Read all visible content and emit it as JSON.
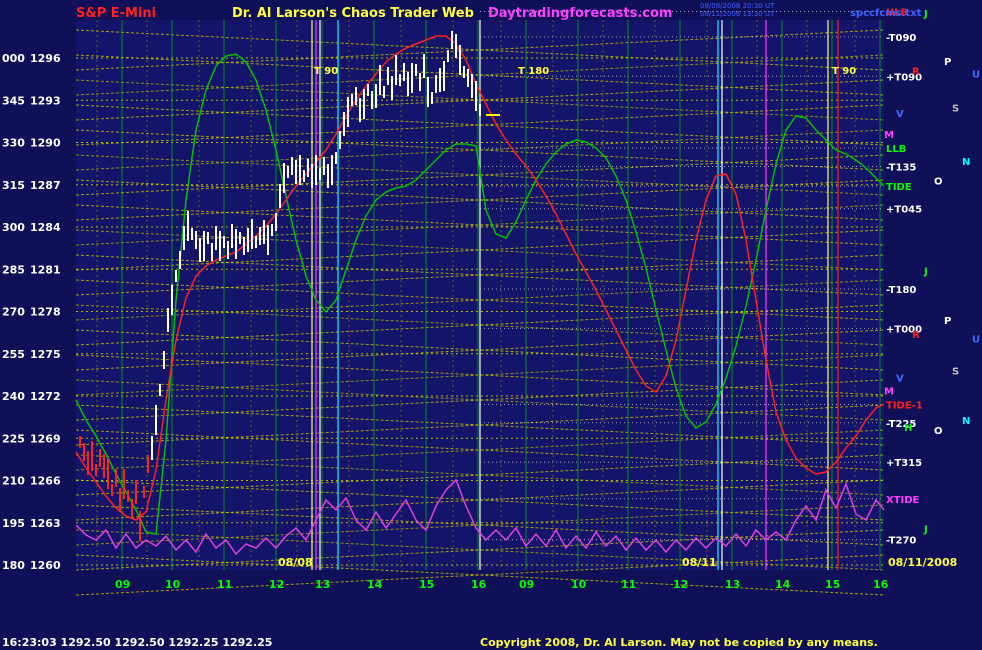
{
  "header": {
    "instrument": "S&P E-Mini",
    "site": "Dr. Al Larson's Chaos Trader Web",
    "url": "Daytradingforecasts.com",
    "stamp_line1": "08/08/2008 20:30 UT",
    "stamp_line2": "08/11/2008 13:30 UT",
    "file_label": "spccfcms.txt"
  },
  "footer": {
    "quote": "16:23:03  1292.50  1292.50  1292.25  1292.25",
    "copyright": "Copyright 2008, Dr. Al Larson. May not be copied by any means."
  },
  "colors": {
    "background": "#101058",
    "plot_background": "#14146a",
    "price_bar": "#ffffff",
    "grid": "#c8c800",
    "time_line": "#00ff00",
    "red_wave": "#ff2020",
    "green_wave": "#00c000",
    "magenta_wave": "#e040e0"
  },
  "chart_data": {
    "type": "line",
    "title": "S&P E-Mini",
    "y_left_labels": [
      "000",
      "345",
      "330",
      "315",
      "300",
      "285",
      "270",
      "255",
      "240",
      "225",
      "210",
      "195",
      "180"
    ],
    "y_prices": [
      1296,
      1293,
      1290,
      1287,
      1284,
      1281,
      1278,
      1275,
      1272,
      1269,
      1266,
      1263,
      1260
    ],
    "ylim": [
      1260,
      1298.7
    ],
    "x_hour_labels": [
      "09",
      "10",
      "11",
      "12",
      "13",
      "14",
      "15",
      "16",
      "09",
      "10",
      "11",
      "12",
      "13",
      "14",
      "15",
      "16"
    ],
    "date_labels": [
      "08/08",
      "08/11",
      "08/11/2008"
    ],
    "right_labels": [
      {
        "text": "-T090",
        "price": 1297.5,
        "color": "#ffffff"
      },
      {
        "text": "+T090",
        "price": 1294.7,
        "color": "#ffffff"
      },
      {
        "text": "-T135",
        "price": 1288.3,
        "color": "#ffffff"
      },
      {
        "text": "+T045",
        "price": 1285.3,
        "color": "#ffffff"
      },
      {
        "text": "-T180",
        "price": 1279.6,
        "color": "#ffffff"
      },
      {
        "text": "+T000",
        "price": 1276.8,
        "color": "#ffffff"
      },
      {
        "text": "-T225",
        "price": 1270.1,
        "color": "#ffffff"
      },
      {
        "text": "+T315",
        "price": 1267.3,
        "color": "#ffffff"
      },
      {
        "text": "-T270",
        "price": 1261.8,
        "color": "#ffffff"
      },
      {
        "text": "ULB",
        "price": 1299.3,
        "color": "#ff2020"
      },
      {
        "text": "LLB",
        "price": 1289.6,
        "color": "#00ff00"
      },
      {
        "text": "TIDE",
        "price": 1286.9,
        "color": "#00ff00"
      },
      {
        "text": "TIDE-1",
        "price": 1271.4,
        "color": "#ff2020"
      },
      {
        "text": "XTIDE",
        "price": 1264.7,
        "color": "#ff40ff"
      }
    ],
    "planet_glyphs": [
      {
        "text": "J",
        "price": 1299.2,
        "color": "#00ff00"
      },
      {
        "text": "P",
        "price": 1295.8,
        "color": "#ffffff"
      },
      {
        "text": "U",
        "price": 1294.9,
        "color": "#3f6bff"
      },
      {
        "text": "R",
        "price": 1295.1,
        "color": "#ff2020"
      },
      {
        "text": "V",
        "price": 1292.1,
        "color": "#3f6bff"
      },
      {
        "text": "S",
        "price": 1292.5,
        "color": "#c0c0c0"
      },
      {
        "text": "M",
        "price": 1290.6,
        "color": "#ff40ff"
      },
      {
        "text": "N",
        "price": 1288.7,
        "color": "#00ffff"
      },
      {
        "text": "O",
        "price": 1287.3,
        "color": "#ffffff"
      },
      {
        "text": "J",
        "price": 1280.9,
        "color": "#00ff00"
      },
      {
        "text": "P",
        "price": 1277.4,
        "color": "#ffffff"
      },
      {
        "text": "R",
        "price": 1276.4,
        "color": "#ff2020"
      },
      {
        "text": "U",
        "price": 1276.1,
        "color": "#3f6bff"
      },
      {
        "text": "S",
        "price": 1273.8,
        "color": "#c0c0c0"
      },
      {
        "text": "V",
        "price": 1273.3,
        "color": "#3f6bff"
      },
      {
        "text": "M",
        "price": 1272.4,
        "color": "#ff40ff"
      },
      {
        "text": "N",
        "price": 1270.3,
        "color": "#00ffff"
      },
      {
        "text": "H",
        "price": 1269.8,
        "color": "#00ff00"
      },
      {
        "text": "O",
        "price": 1269.6,
        "color": "#ffffff"
      },
      {
        "text": "J",
        "price": 1262.6,
        "color": "#00ff00"
      }
    ],
    "time_line_labels": [
      "T 90",
      "T 180",
      "T 90"
    ],
    "price_series": [
      [
        80,
        442
      ],
      [
        84,
        452
      ],
      [
        88,
        463
      ],
      [
        92,
        456
      ],
      [
        96,
        470
      ],
      [
        100,
        458
      ],
      [
        104,
        466
      ],
      [
        108,
        474
      ],
      [
        112,
        490
      ],
      [
        116,
        478
      ],
      [
        120,
        500
      ],
      [
        124,
        484
      ],
      [
        128,
        496
      ],
      [
        132,
        508
      ],
      [
        136,
        492
      ],
      [
        140,
        526
      ],
      [
        144,
        492
      ],
      [
        148,
        464
      ],
      [
        152,
        448
      ],
      [
        156,
        420
      ],
      [
        160,
        390
      ],
      [
        164,
        360
      ],
      [
        168,
        320
      ],
      [
        172,
        300
      ],
      [
        176,
        276
      ],
      [
        180,
        260
      ],
      [
        184,
        238
      ],
      [
        188,
        226
      ],
      [
        192,
        234
      ],
      [
        196,
        240
      ],
      [
        200,
        250
      ],
      [
        204,
        246
      ],
      [
        208,
        238
      ],
      [
        212,
        252
      ],
      [
        216,
        238
      ],
      [
        220,
        246
      ],
      [
        224,
        242
      ],
      [
        228,
        250
      ],
      [
        232,
        236
      ],
      [
        236,
        244
      ],
      [
        240,
        238
      ],
      [
        244,
        246
      ],
      [
        248,
        240
      ],
      [
        252,
        234
      ],
      [
        256,
        242
      ],
      [
        260,
        236
      ],
      [
        264,
        232
      ],
      [
        268,
        240
      ],
      [
        272,
        230
      ],
      [
        276,
        222
      ],
      [
        280,
        196
      ],
      [
        284,
        178
      ],
      [
        288,
        172
      ],
      [
        292,
        166
      ],
      [
        296,
        172
      ],
      [
        300,
        170
      ],
      [
        304,
        176
      ],
      [
        308,
        168
      ],
      [
        312,
        176
      ],
      [
        316,
        170
      ],
      [
        320,
        174
      ],
      [
        324,
        166
      ],
      [
        328,
        176
      ],
      [
        332,
        170
      ],
      [
        336,
        158
      ],
      [
        340,
        140
      ],
      [
        344,
        124
      ],
      [
        348,
        112
      ],
      [
        352,
        100
      ],
      [
        356,
        96
      ],
      [
        360,
        110
      ],
      [
        364,
        104
      ],
      [
        368,
        90
      ],
      [
        372,
        100
      ],
      [
        376,
        96
      ],
      [
        380,
        80
      ],
      [
        384,
        92
      ],
      [
        388,
        76
      ],
      [
        392,
        88
      ],
      [
        396,
        70
      ],
      [
        400,
        80
      ],
      [
        404,
        72
      ],
      [
        408,
        84
      ],
      [
        412,
        78
      ],
      [
        416,
        70
      ],
      [
        420,
        82
      ],
      [
        424,
        66
      ],
      [
        428,
        92
      ],
      [
        432,
        98
      ],
      [
        436,
        84
      ],
      [
        440,
        80
      ],
      [
        444,
        76
      ],
      [
        448,
        56
      ],
      [
        452,
        40
      ],
      [
        456,
        46
      ],
      [
        460,
        60
      ],
      [
        464,
        72
      ],
      [
        468,
        78
      ],
      [
        472,
        86
      ],
      [
        476,
        96
      ],
      [
        480,
        110
      ]
    ],
    "red_series": [
      [
        76,
        452
      ],
      [
        86,
        468
      ],
      [
        96,
        482
      ],
      [
        106,
        496
      ],
      [
        116,
        508
      ],
      [
        126,
        516
      ],
      [
        136,
        520
      ],
      [
        146,
        512
      ],
      [
        156,
        470
      ],
      [
        166,
        400
      ],
      [
        176,
        340
      ],
      [
        186,
        298
      ],
      [
        196,
        276
      ],
      [
        206,
        266
      ],
      [
        216,
        260
      ],
      [
        226,
        256
      ],
      [
        236,
        252
      ],
      [
        246,
        244
      ],
      [
        256,
        236
      ],
      [
        266,
        226
      ],
      [
        276,
        214
      ],
      [
        286,
        200
      ],
      [
        296,
        186
      ],
      [
        306,
        174
      ],
      [
        316,
        162
      ],
      [
        326,
        150
      ],
      [
        336,
        134
      ],
      [
        346,
        116
      ],
      [
        356,
        100
      ],
      [
        366,
        86
      ],
      [
        376,
        74
      ],
      [
        386,
        62
      ],
      [
        396,
        54
      ],
      [
        406,
        48
      ],
      [
        416,
        44
      ],
      [
        426,
        40
      ],
      [
        436,
        36
      ],
      [
        446,
        36
      ],
      [
        456,
        44
      ],
      [
        466,
        60
      ],
      [
        476,
        84
      ],
      [
        486,
        104
      ],
      [
        496,
        124
      ],
      [
        506,
        140
      ],
      [
        516,
        154
      ],
      [
        526,
        166
      ],
      [
        536,
        180
      ],
      [
        546,
        196
      ],
      [
        556,
        214
      ],
      [
        566,
        234
      ],
      [
        576,
        254
      ],
      [
        586,
        272
      ],
      [
        596,
        290
      ],
      [
        606,
        310
      ],
      [
        616,
        330
      ],
      [
        626,
        350
      ],
      [
        636,
        370
      ],
      [
        646,
        386
      ],
      [
        656,
        392
      ],
      [
        666,
        376
      ],
      [
        676,
        340
      ],
      [
        686,
        290
      ],
      [
        696,
        240
      ],
      [
        706,
        200
      ],
      [
        716,
        176
      ],
      [
        726,
        174
      ],
      [
        736,
        194
      ],
      [
        746,
        240
      ],
      [
        756,
        300
      ],
      [
        766,
        360
      ],
      [
        776,
        412
      ],
      [
        786,
        440
      ],
      [
        796,
        458
      ],
      [
        806,
        468
      ],
      [
        816,
        474
      ],
      [
        826,
        472
      ],
      [
        836,
        462
      ],
      [
        846,
        448
      ],
      [
        856,
        436
      ],
      [
        866,
        420
      ],
      [
        876,
        408
      ],
      [
        884,
        404
      ]
    ],
    "green_series": [
      [
        76,
        400
      ],
      [
        86,
        420
      ],
      [
        96,
        436
      ],
      [
        106,
        454
      ],
      [
        116,
        474
      ],
      [
        126,
        492
      ],
      [
        136,
        510
      ],
      [
        146,
        532
      ],
      [
        156,
        534
      ],
      [
        166,
        440
      ],
      [
        176,
        300
      ],
      [
        186,
        200
      ],
      [
        196,
        130
      ],
      [
        206,
        90
      ],
      [
        216,
        66
      ],
      [
        226,
        56
      ],
      [
        236,
        54
      ],
      [
        246,
        62
      ],
      [
        256,
        80
      ],
      [
        266,
        110
      ],
      [
        276,
        150
      ],
      [
        286,
        196
      ],
      [
        296,
        240
      ],
      [
        306,
        276
      ],
      [
        316,
        300
      ],
      [
        326,
        312
      ],
      [
        336,
        300
      ],
      [
        346,
        270
      ],
      [
        356,
        240
      ],
      [
        366,
        216
      ],
      [
        376,
        200
      ],
      [
        386,
        192
      ],
      [
        396,
        188
      ],
      [
        406,
        186
      ],
      [
        416,
        180
      ],
      [
        426,
        170
      ],
      [
        436,
        160
      ],
      [
        446,
        150
      ],
      [
        456,
        144
      ],
      [
        466,
        144
      ],
      [
        476,
        146
      ],
      [
        486,
        210
      ],
      [
        496,
        234
      ],
      [
        506,
        238
      ],
      [
        516,
        222
      ],
      [
        526,
        200
      ],
      [
        536,
        180
      ],
      [
        546,
        164
      ],
      [
        556,
        152
      ],
      [
        566,
        144
      ],
      [
        576,
        140
      ],
      [
        586,
        142
      ],
      [
        596,
        148
      ],
      [
        606,
        158
      ],
      [
        616,
        176
      ],
      [
        626,
        200
      ],
      [
        636,
        232
      ],
      [
        646,
        268
      ],
      [
        656,
        310
      ],
      [
        666,
        350
      ],
      [
        676,
        388
      ],
      [
        686,
        416
      ],
      [
        696,
        428
      ],
      [
        706,
        422
      ],
      [
        716,
        404
      ],
      [
        726,
        378
      ],
      [
        736,
        346
      ],
      [
        746,
        306
      ],
      [
        756,
        260
      ],
      [
        766,
        210
      ],
      [
        776,
        164
      ],
      [
        786,
        130
      ],
      [
        796,
        116
      ],
      [
        806,
        118
      ],
      [
        816,
        130
      ],
      [
        826,
        140
      ],
      [
        836,
        150
      ],
      [
        846,
        154
      ],
      [
        856,
        160
      ],
      [
        866,
        168
      ],
      [
        876,
        178
      ],
      [
        884,
        186
      ]
    ],
    "magenta_series": [
      [
        76,
        525
      ],
      [
        86,
        535
      ],
      [
        96,
        540
      ],
      [
        106,
        530
      ],
      [
        116,
        548
      ],
      [
        126,
        534
      ],
      [
        136,
        548
      ],
      [
        146,
        540
      ],
      [
        156,
        546
      ],
      [
        166,
        536
      ],
      [
        176,
        550
      ],
      [
        186,
        540
      ],
      [
        196,
        552
      ],
      [
        206,
        534
      ],
      [
        216,
        548
      ],
      [
        226,
        540
      ],
      [
        236,
        554
      ],
      [
        246,
        544
      ],
      [
        256,
        548
      ],
      [
        266,
        538
      ],
      [
        276,
        548
      ],
      [
        286,
        536
      ],
      [
        296,
        528
      ],
      [
        306,
        540
      ],
      [
        316,
        520
      ],
      [
        326,
        500
      ],
      [
        336,
        510
      ],
      [
        346,
        498
      ],
      [
        356,
        520
      ],
      [
        366,
        530
      ],
      [
        376,
        512
      ],
      [
        386,
        528
      ],
      [
        396,
        514
      ],
      [
        406,
        500
      ],
      [
        416,
        520
      ],
      [
        426,
        530
      ],
      [
        436,
        506
      ],
      [
        446,
        490
      ],
      [
        456,
        480
      ],
      [
        466,
        506
      ],
      [
        476,
        528
      ],
      [
        486,
        540
      ],
      [
        496,
        530
      ],
      [
        506,
        540
      ],
      [
        516,
        528
      ],
      [
        526,
        546
      ],
      [
        536,
        534
      ],
      [
        546,
        546
      ],
      [
        556,
        530
      ],
      [
        566,
        548
      ],
      [
        576,
        536
      ],
      [
        586,
        548
      ],
      [
        596,
        532
      ],
      [
        606,
        546
      ],
      [
        616,
        536
      ],
      [
        626,
        550
      ],
      [
        636,
        538
      ],
      [
        646,
        550
      ],
      [
        656,
        540
      ],
      [
        666,
        552
      ],
      [
        676,
        540
      ],
      [
        686,
        550
      ],
      [
        696,
        538
      ],
      [
        706,
        548
      ],
      [
        716,
        538
      ],
      [
        726,
        546
      ],
      [
        736,
        534
      ],
      [
        746,
        546
      ],
      [
        756,
        530
      ],
      [
        766,
        540
      ],
      [
        776,
        532
      ],
      [
        786,
        540
      ],
      [
        796,
        520
      ],
      [
        806,
        506
      ],
      [
        816,
        520
      ],
      [
        826,
        490
      ],
      [
        836,
        508
      ],
      [
        846,
        484
      ],
      [
        856,
        514
      ],
      [
        866,
        520
      ],
      [
        876,
        500
      ],
      [
        884,
        510
      ]
    ]
  }
}
